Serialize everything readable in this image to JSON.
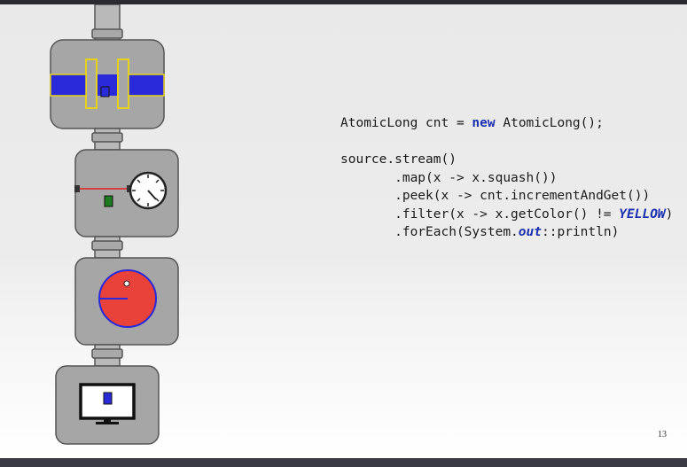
{
  "code": {
    "line1_type": "AtomicLong",
    "line1_var": " cnt = ",
    "line1_new": "new",
    "line1_rest": " AtomicLong();",
    "line2": "source.stream()",
    "line3": "       .map(x -> x.squash())",
    "line4": "       .peek(x -> cnt.incrementAndGet())",
    "line5_a": "       .filter(x -> x.getColor() != ",
    "line5_const": "YELLOW",
    "line5_b": ")",
    "line6_a": "       .forEach(System.",
    "line6_field": "out",
    "line6_b": "::println)"
  },
  "page_number": "13",
  "colors": {
    "station_fill": "#a6a6a6",
    "station_border": "#555555",
    "pipe": "#b9b9b9",
    "blue_item": "#2a2ad8",
    "yellow_outline": "#e6d21a",
    "red_circle": "#e8423a",
    "green_item": "#1f7a1f",
    "laser": "#e02020"
  },
  "icons": {
    "squash": "press-icon",
    "peek": "clock-counter-icon",
    "filter": "pacman-filter-icon",
    "forEach": "monitor-icon"
  }
}
